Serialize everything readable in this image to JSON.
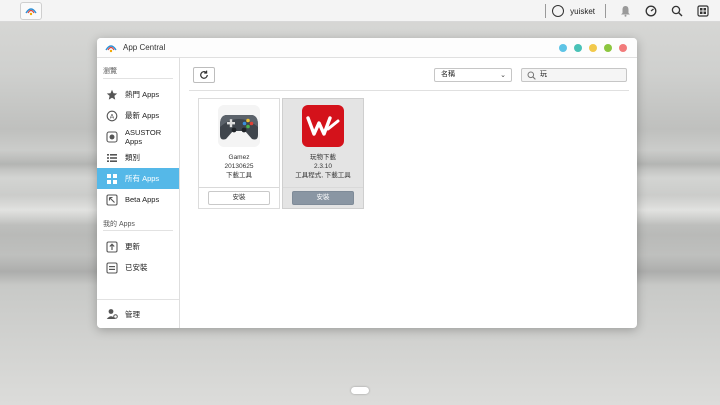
{
  "topbar": {
    "user_name": "yuisket"
  },
  "window": {
    "title": "App Central",
    "dots": [
      "#5ec4e6",
      "#49c2b7",
      "#f2c94c",
      "#8cc63f",
      "#f27b7b"
    ]
  },
  "sidebar": {
    "browse_label": "瀏覽",
    "items": [
      {
        "label": "熱門 Apps",
        "icon": "star-icon"
      },
      {
        "label": "最新 Apps",
        "icon": "new-icon"
      },
      {
        "label": "ASUSTOR Apps",
        "icon": "asustor-icon"
      },
      {
        "label": "類別",
        "icon": "list-icon"
      },
      {
        "label": "所有 Apps",
        "icon": "grid-icon",
        "active": true
      },
      {
        "label": "Beta Apps",
        "icon": "beta-icon"
      }
    ],
    "my_apps_label": "我的 Apps",
    "my_items": [
      {
        "label": "更新",
        "icon": "update-icon"
      },
      {
        "label": "已安裝",
        "icon": "installed-icon"
      }
    ],
    "manage_label": "管理"
  },
  "toolbar": {
    "sort_value": "名稱",
    "search_value": "玩"
  },
  "apps": [
    {
      "name": "Gamez",
      "version": "20130625",
      "category": "下載工具",
      "install_label": "安裝",
      "icon": "gamepad-icon"
    },
    {
      "name": "玩物下載",
      "version": "2.3.10",
      "category": "工具程式, 下載工具",
      "install_label": "安裝",
      "icon": "wanwu-icon"
    }
  ],
  "colors": {
    "accent": "#55b8e8",
    "wanwu_red": "#d4121b"
  }
}
